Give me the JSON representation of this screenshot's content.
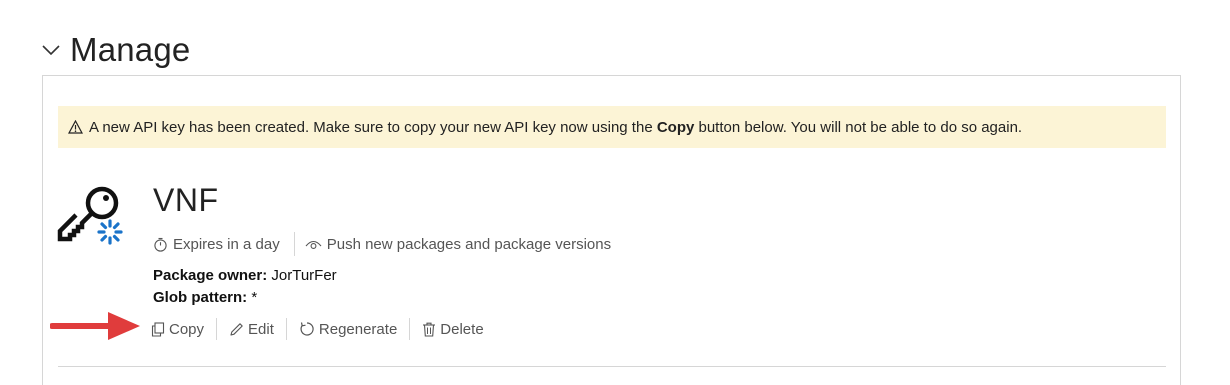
{
  "section": {
    "title": "Manage",
    "chevron_icon": "chevron-down-icon"
  },
  "alert": {
    "icon": "warning-icon",
    "text_before": "A new API key has been created. Make sure to copy your new API key now using the ",
    "text_bold": "Copy",
    "text_after": " button below. You will not be able to do so again."
  },
  "api_key": {
    "icon": "api-key-icon",
    "name": "VNF",
    "expires": "Expires in a day",
    "scope": "Push new packages and package versions",
    "package_owner_label": "Package owner:",
    "package_owner_value": "JorTurFer",
    "glob_pattern_label": "Glob pattern:",
    "glob_pattern_value": "*"
  },
  "actions": {
    "copy": "Copy",
    "edit": "Edit",
    "regenerate": "Regenerate",
    "delete": "Delete"
  },
  "colors": {
    "alert_background": "#fcf4d6",
    "arrow": "#e03c3c",
    "key_badge": "#1a73c9"
  }
}
